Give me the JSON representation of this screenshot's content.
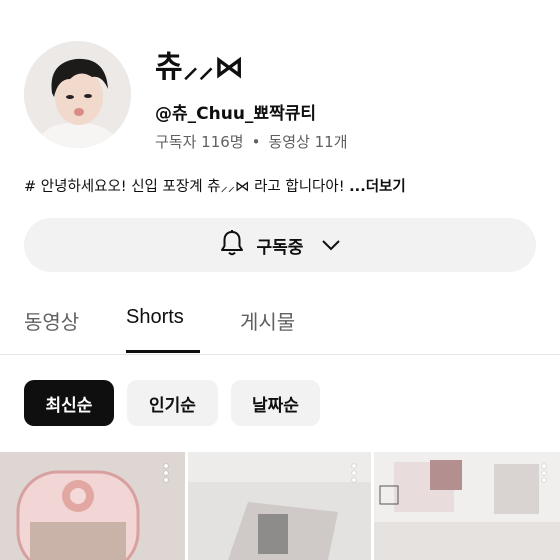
{
  "channel": {
    "name": "츄⸝⸝⋈",
    "handle": "@츄_Chuu_뾰짝큐티",
    "subscribers": "구독자 116명",
    "separator": "•",
    "videos_count": "동영상 11개",
    "description": "# 안녕하세요오! 신입 포장계 츄⸝⸝⋈ 라고 합니다아!",
    "more_label": "...더보기"
  },
  "subscribe": {
    "label": "구독중",
    "bell_icon": "bell-icon",
    "chevron_icon": "chevron-down-icon"
  },
  "tabs": [
    {
      "label": "동영상",
      "active": false
    },
    {
      "label": "Shorts",
      "active": true
    },
    {
      "label": "게시물",
      "active": false
    }
  ],
  "chips": [
    {
      "label": "최신순",
      "active": true
    },
    {
      "label": "인기순",
      "active": false
    },
    {
      "label": "날짜순",
      "active": false
    }
  ],
  "colors": {
    "text_primary": "#0f0f0f",
    "text_secondary": "#606060",
    "chip_bg": "#f2f2f2",
    "chip_active_bg": "#0f0f0f"
  }
}
